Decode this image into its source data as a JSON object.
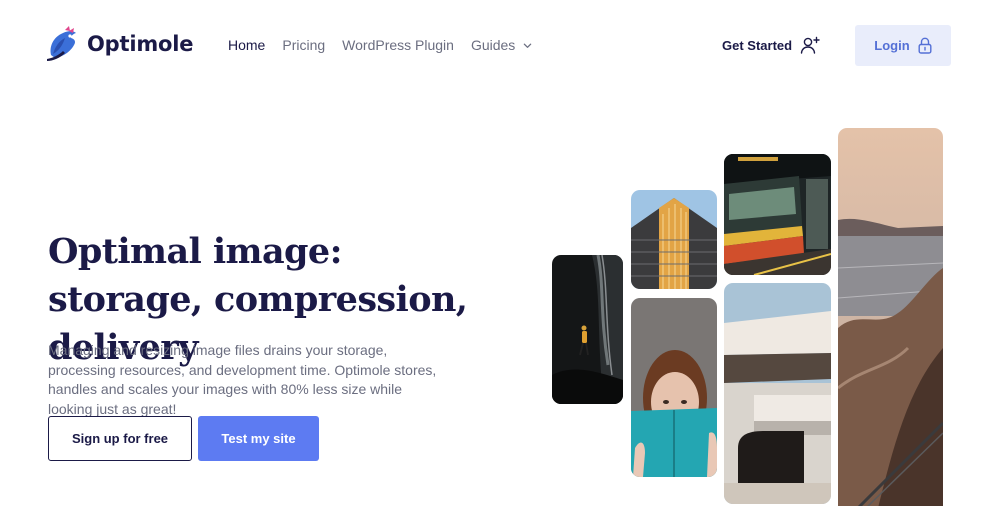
{
  "brand": {
    "name": "Optimole",
    "logo_icon": "mole-mascot-icon",
    "color": "#1b1a47"
  },
  "nav": {
    "items": [
      {
        "label": "Home",
        "active": true
      },
      {
        "label": "Pricing",
        "active": false
      },
      {
        "label": "WordPress Plugin",
        "active": false
      },
      {
        "label": "Guides",
        "active": false,
        "icon": "chevron-down-icon"
      }
    ]
  },
  "header": {
    "get_started": "Get Started",
    "get_started_icon": "user-plus-icon",
    "login": "Login",
    "login_icon": "lock-icon",
    "login_bg": "#e9edfb",
    "login_color": "#5470d6"
  },
  "hero": {
    "title": "Optimal image: storage, compression, delivery",
    "description": "Managing and resizing image files drains your storage, processing resources, and development time. Optimole stores, handles and scales your images with 80% less size while looking just as great!",
    "cta_secondary": "Sign up for free",
    "cta_primary": "Test my site",
    "primary_color": "#5d7bf2"
  },
  "gallery": {
    "images": [
      "person-in-cave-photo",
      "building-facade-photo",
      "woman-with-book-photo",
      "subway-train-photo",
      "concrete-building-photo",
      "coastal-cliff-photo"
    ]
  }
}
